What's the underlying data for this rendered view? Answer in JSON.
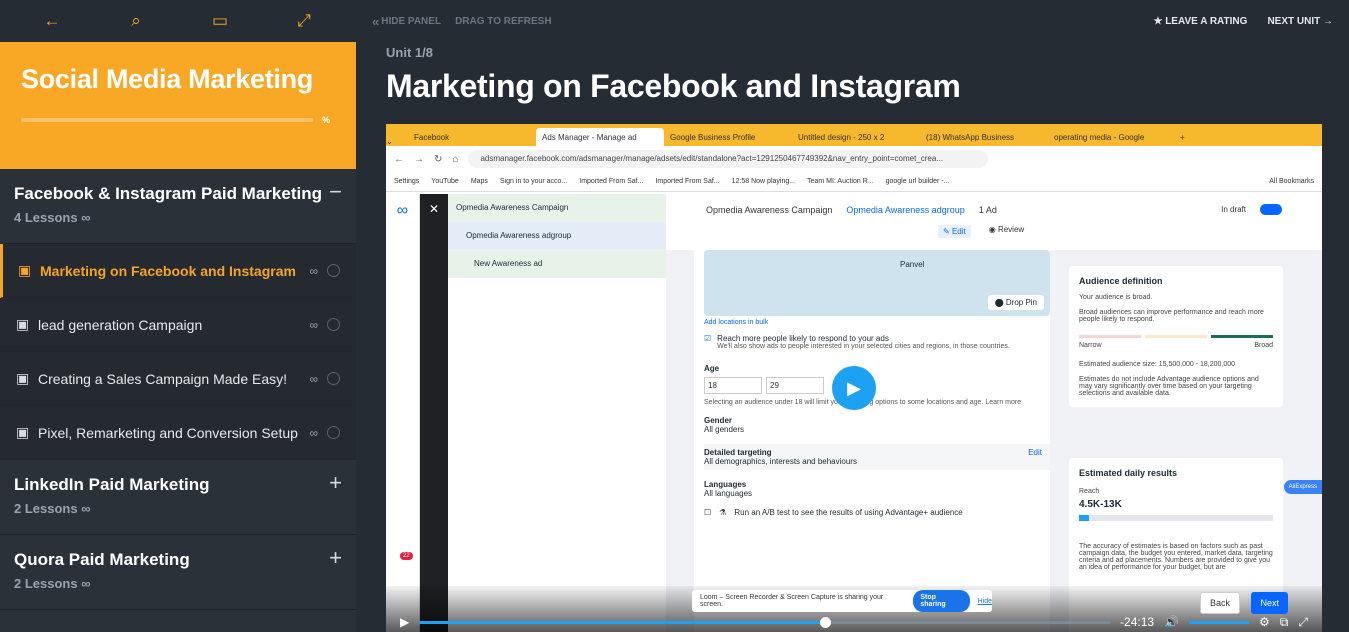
{
  "course": {
    "title": "Social Media Marketing",
    "progress_label": "%"
  },
  "sections": [
    {
      "title": "Facebook & Instagram Paid Marketing",
      "count": "4 Lessons",
      "toggle": "−"
    },
    {
      "title": "LinkedIn Paid Marketing",
      "count": "2 Lessons",
      "toggle": "+"
    },
    {
      "title": "Quora Paid Marketing",
      "count": "2 Lessons",
      "toggle": "+"
    }
  ],
  "lessons": [
    {
      "title": "Marketing on Facebook and Instagram",
      "active": true
    },
    {
      "title": "lead generation Campaign"
    },
    {
      "title": "Creating a Sales Campaign Made Easy!"
    },
    {
      "title": "Pixel, Remarketing and Conversion Setup"
    }
  ],
  "topbar": {
    "hide": "HIDE PANEL",
    "refresh": "DRAG TO REFRESH",
    "rate": "LEAVE A RATING",
    "next": "NEXT UNIT"
  },
  "unit": {
    "label": "Unit 1/8",
    "title": "Marketing on Facebook and Instagram"
  },
  "browser": {
    "tabs": [
      "Facebook",
      "Ads Manager - Manage ad",
      "Google Business Profile",
      "Untitled design - 250 x 2",
      "(18) WhatsApp Business",
      "operating media - Google"
    ],
    "url": "adsmanager.facebook.com/adsmanager/manage/adsets/edit/standalone?act=1291250467749392&nav_entry_point=comet_crea...",
    "bookmarks": [
      "Settings",
      "YouTube",
      "Maps",
      "Sign in to your acco...",
      "Imported From Saf...",
      "Imported From Saf...",
      "12:58 Now playing...",
      "Team MI: Auction R...",
      "google url builder -...",
      "All Bookmarks"
    ]
  },
  "ads": {
    "tree": [
      "Opmedia Awareness Campaign",
      "Opmedia Awareness adgroup",
      "New Awareness ad"
    ],
    "breadcrumb": [
      "Opmedia Awareness Campaign",
      "Opmedia Awareness adgroup",
      "1 Ad"
    ],
    "draft": "In draft",
    "edit": "Edit",
    "review": "Review",
    "add_locations": "Add locations in bulk",
    "reach_more": "Reach more people likely to respond to your ads",
    "reach_more_sub": "We'll also show ads to people interested in your selected cities and regions, in those countries.",
    "age_label": "Age",
    "age_min": "18",
    "age_max": "29",
    "age_note": "Selecting an audience under 18 will limit your targeting options to some locations and age. Learn more",
    "gender_label": "Gender",
    "gender_value": "All genders",
    "detailed_label": "Detailed targeting",
    "detailed_value": "All demographics, interests and behaviours",
    "detailed_edit": "Edit",
    "lang_label": "Languages",
    "lang_value": "All languages",
    "ab_test": "Run an A/B test to see the results of using Advantage+ audience",
    "map_city": "Panvel",
    "drop_pin": "Drop Pin",
    "audience_title": "Audience definition",
    "audience_broad": "Your audience is broad.",
    "audience_tip": "Broad audiences can improve performance and reach more people likely to respond.",
    "narrow": "Narrow",
    "broad": "Broad",
    "est_size": "Estimated audience size: 15,500,000 - 18,200,000",
    "est_note": "Estimates do not include Advantage audience options and may vary significantly over time based on your targeting selections and available data.",
    "daily_title": "Estimated daily results",
    "reach_label": "Reach",
    "reach_value": "4.5K-13K",
    "accuracy": "The accuracy of estimates is based on factors such as past campaign data, the budget you entered, market data, targeting criteria and ad placements. Numbers are provided to give you an idea of performance for your budget, but are",
    "aliexpress": "AliExpress"
  },
  "notice": {
    "text": "Loom – Screen Recorder & Screen Capture is sharing your screen.",
    "stop": "Stop sharing",
    "hide": "Hide"
  },
  "nav": {
    "back": "Back",
    "next": "Next"
  },
  "video": {
    "time": "-24:13",
    "progress_fraction": 0.58
  },
  "badge": "22"
}
